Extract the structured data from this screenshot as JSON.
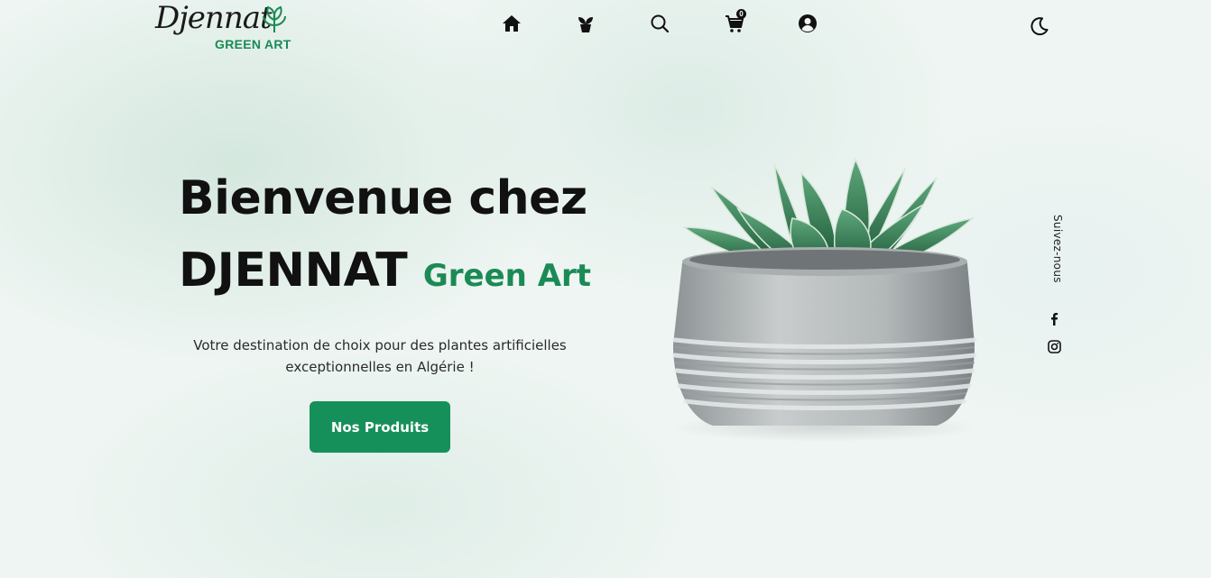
{
  "brand": {
    "script_text": "Djennat",
    "sub_text": "GREEN ART",
    "accent_color": "#1b8a55"
  },
  "nav": {
    "icons": [
      "home-icon",
      "plant-icon",
      "search-icon",
      "cart-icon",
      "user-icon"
    ],
    "cart_count": "0",
    "theme_icon": "moon-icon"
  },
  "hero": {
    "title_line1": "Bienvenue chez",
    "title_line2_main": "DJENNAT",
    "title_line2_accent": "Green Art",
    "subtitle": "Votre destination de choix pour des plantes artificielles exceptionnelles en Algérie !",
    "cta_label": "Nos Produits",
    "cta_color": "#16905a"
  },
  "social": {
    "label": "Suivez-nous",
    "icons": [
      "facebook-icon",
      "instagram-icon"
    ]
  }
}
